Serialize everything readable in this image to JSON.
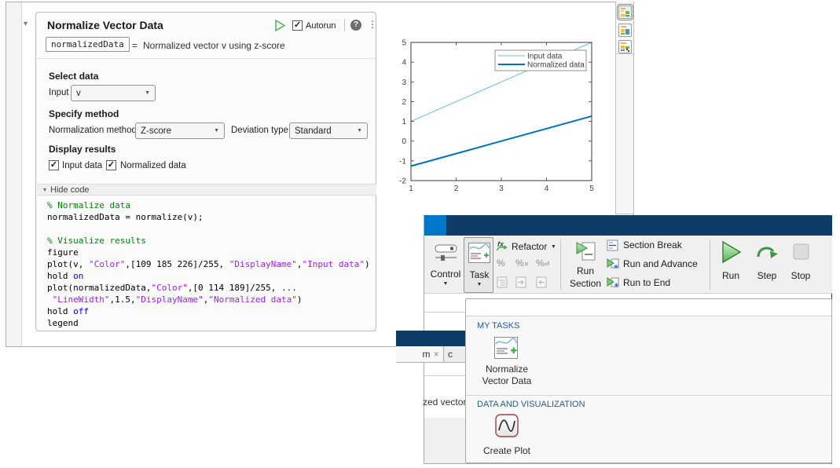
{
  "icons": {
    "collapse_arrow": "▾",
    "dropdown_arrow": "▼",
    "check": "✓",
    "help": "?",
    "menu_dots": "⋮",
    "close": "✕",
    "percent": "%",
    "hide_code_arrow": "▾"
  },
  "live_editor": {
    "task": {
      "title": "Normalize Vector Data",
      "autorun_label": "Autorun",
      "output_var": "normalizedData",
      "equals": "=",
      "summary": "Normalized vector v using z-score",
      "select_data_header": "Select data",
      "input_data_label": "Input data",
      "input_data_value": "v",
      "specify_method_header": "Specify method",
      "normalization_method_label": "Normalization method",
      "normalization_method_value": "Z-score",
      "deviation_type_label": "Deviation type",
      "deviation_type_value": "Standard",
      "display_results_header": "Display results",
      "checkbox_input_data": "Input data",
      "checkbox_normalized_data": "Normalized data",
      "hide_code_label": "Hide code",
      "code_lines": [
        [
          {
            "t": "% Normalize data",
            "c": "comment"
          }
        ],
        [
          {
            "t": "normalizedData = normalize(v);",
            "c": "plain"
          }
        ],
        [],
        [
          {
            "t": "% Visualize results",
            "c": "comment"
          }
        ],
        [
          {
            "t": "figure",
            "c": "plain"
          }
        ],
        [
          {
            "t": "plot(v, ",
            "c": "plain"
          },
          {
            "t": "\"Color\"",
            "c": "string"
          },
          {
            "t": ",[109 185 226]/255, ",
            "c": "plain"
          },
          {
            "t": "\"DisplayName\"",
            "c": "string"
          },
          {
            "t": ",",
            "c": "plain"
          },
          {
            "t": "\"Input data\"",
            "c": "string"
          },
          {
            "t": ")",
            "c": "plain"
          }
        ],
        [
          {
            "t": "hold ",
            "c": "plain"
          },
          {
            "t": "on",
            "c": "keyword"
          }
        ],
        [
          {
            "t": "plot(normalizedData,",
            "c": "plain"
          },
          {
            "t": "\"Color\"",
            "c": "string"
          },
          {
            "t": ",[0 114 189]/255, ",
            "c": "plain"
          },
          {
            "t": "...",
            "c": "keyword"
          }
        ],
        [
          {
            "t": " ",
            "c": "plain"
          },
          {
            "t": "\"LineWidth\"",
            "c": "string"
          },
          {
            "t": ",1.5,",
            "c": "plain"
          },
          {
            "t": "\"DisplayName\"",
            "c": "string"
          },
          {
            "t": ",",
            "c": "plain"
          },
          {
            "t": "\"Normalized data\"",
            "c": "string"
          },
          {
            "t": ")",
            "c": "plain"
          }
        ],
        [
          {
            "t": "hold ",
            "c": "plain"
          },
          {
            "t": "off",
            "c": "keyword"
          }
        ],
        [
          {
            "t": "legend",
            "c": "plain"
          }
        ]
      ]
    }
  },
  "chart_data": {
    "type": "line",
    "title": "",
    "xlabel": "",
    "ylabel": "",
    "x": [
      1,
      2,
      3,
      4,
      5
    ],
    "series": [
      {
        "name": "Input data",
        "color": "#6DB9E2",
        "width": 1,
        "values": [
          1,
          2,
          3,
          4,
          5
        ]
      },
      {
        "name": "Normalized data",
        "color": "#0072BD",
        "width": 2,
        "values": [
          -1.2649,
          -0.6325,
          0,
          0.6325,
          1.2649
        ]
      }
    ],
    "xlim": [
      1,
      5
    ],
    "ylim": [
      -2,
      5
    ],
    "xticks": [
      1,
      2,
      3,
      4,
      5
    ],
    "yticks": [
      -2,
      -1,
      0,
      1,
      2,
      3,
      4,
      5
    ],
    "grid": false,
    "legend_position": "top-right"
  },
  "desktop": {
    "toolstrip": {
      "control_label": "Control",
      "task_label": "Task",
      "refactor_label": "Refactor",
      "run_section_line1": "Run",
      "run_section_line2": "Section",
      "section_break_label": "Section Break",
      "run_and_advance_label": "Run and Advance",
      "run_to_end_label": "Run to End",
      "run_label": "Run",
      "step_label": "Step",
      "stop_label": "Stop"
    },
    "gallery": {
      "my_tasks_header": "MY TASKS",
      "normalize_item_line1": "Normalize",
      "normalize_item_line2": "Vector Data",
      "dataviz_header": "DATA AND VISUALIZATION",
      "create_plot_label": "Create Plot"
    },
    "fragments": {
      "tab1_text": "m",
      "tab2_text": "c",
      "partial_text": "zed vector"
    }
  }
}
